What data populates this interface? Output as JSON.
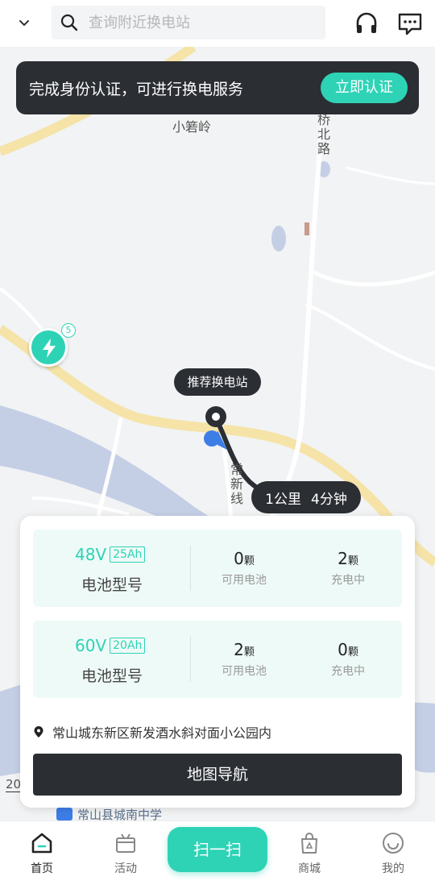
{
  "search": {
    "placeholder": "查询附近换电站"
  },
  "header_icons": [
    "chevron-down-icon",
    "headset-icon",
    "message-icon"
  ],
  "banner": {
    "text": "完成身份认证，可进行换电服务",
    "button": "立即认证"
  },
  "map": {
    "labels": {
      "place": "小箬岭",
      "road_bridge_north": "大桥北路",
      "road_changxin": "常新线",
      "scale": "20",
      "school": "常山县城南中学"
    },
    "station_count": "5",
    "recommend_tip": "推荐换电站",
    "distance": "1公里",
    "duration": "4分钟"
  },
  "batteries": [
    {
      "voltage": "48V",
      "capacity": "25Ah",
      "type_label": "电池型号",
      "available": "0",
      "charging": "2"
    },
    {
      "voltage": "60V",
      "capacity": "20Ah",
      "type_label": "电池型号",
      "available": "2",
      "charging": "0"
    }
  ],
  "stat_labels": {
    "unit": "颗",
    "available": "可用电池",
    "charging": "充电中"
  },
  "address": "常山城东新区新发酒水斜对面小公园内",
  "nav_button": "地图导航",
  "tabs": [
    {
      "label": "首页",
      "icon": "home-icon",
      "active": true
    },
    {
      "label": "活动",
      "icon": "activity-icon",
      "active": false
    },
    {
      "label": "商城",
      "icon": "shop-bag-icon",
      "active": false
    },
    {
      "label": "我的",
      "icon": "profile-icon",
      "active": false
    }
  ],
  "scan_button": "扫一扫",
  "colors": {
    "accent": "#2ed3b6",
    "dark": "#2b2e33",
    "river": "#c4cfe6",
    "road": "#f5e3a8"
  }
}
